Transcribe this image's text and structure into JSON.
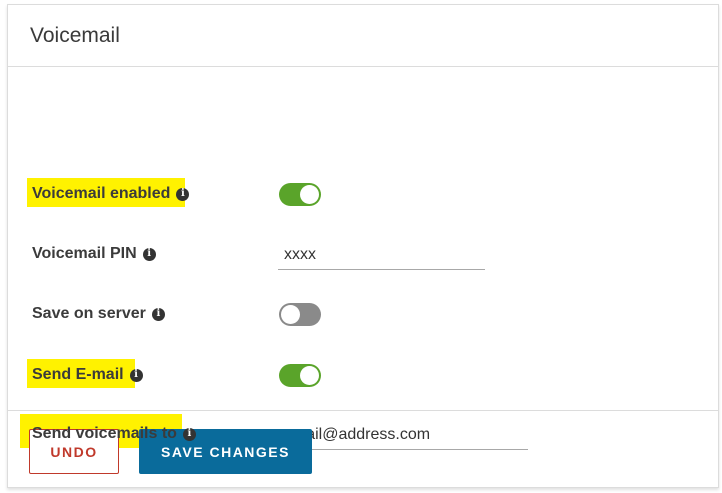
{
  "card": {
    "title": "Voicemail"
  },
  "settings": {
    "voicemail_enabled": {
      "label": "Voicemail enabled",
      "highlighted": true,
      "value": true
    },
    "voicemail_pin": {
      "label": "Voicemail PIN",
      "highlighted": false,
      "value": "xxxx"
    },
    "save_on_server": {
      "label": "Save on server",
      "highlighted": false,
      "value": false
    },
    "send_email": {
      "label": "Send E-mail",
      "highlighted": true,
      "value": true
    },
    "send_voicemails_to": {
      "label": "Send voicemails to",
      "highlighted": true,
      "value": "email@address.com"
    }
  },
  "footer": {
    "undo_label": "UNDO",
    "save_label": "SAVE CHANGES"
  },
  "icons": {
    "info": "info-icon"
  },
  "colors": {
    "toggle_on": "#5aa42a",
    "toggle_off": "#8a8a8a",
    "highlight": "#fff200",
    "undo_border": "#c0392b",
    "save_background": "#0a6b9b"
  }
}
